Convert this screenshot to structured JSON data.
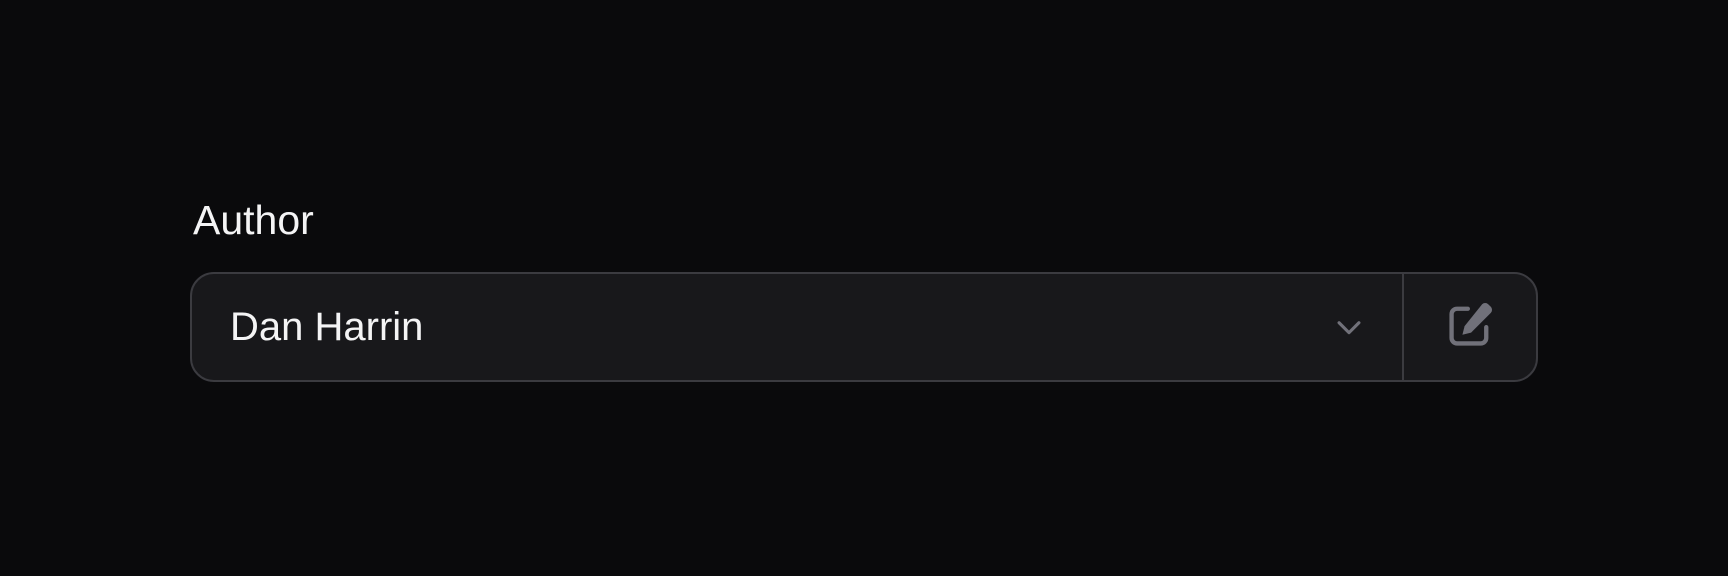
{
  "field": {
    "label": "Author",
    "selected_value": "Dan Harrin"
  },
  "icons": {
    "dropdown": "chevron-down-icon",
    "edit": "pencil-square-icon"
  },
  "colors": {
    "background": "#0a0a0c",
    "input_background": "#18181b",
    "border": "#3b3b40",
    "text": "#f4f4f5",
    "icon": "#71717a"
  }
}
